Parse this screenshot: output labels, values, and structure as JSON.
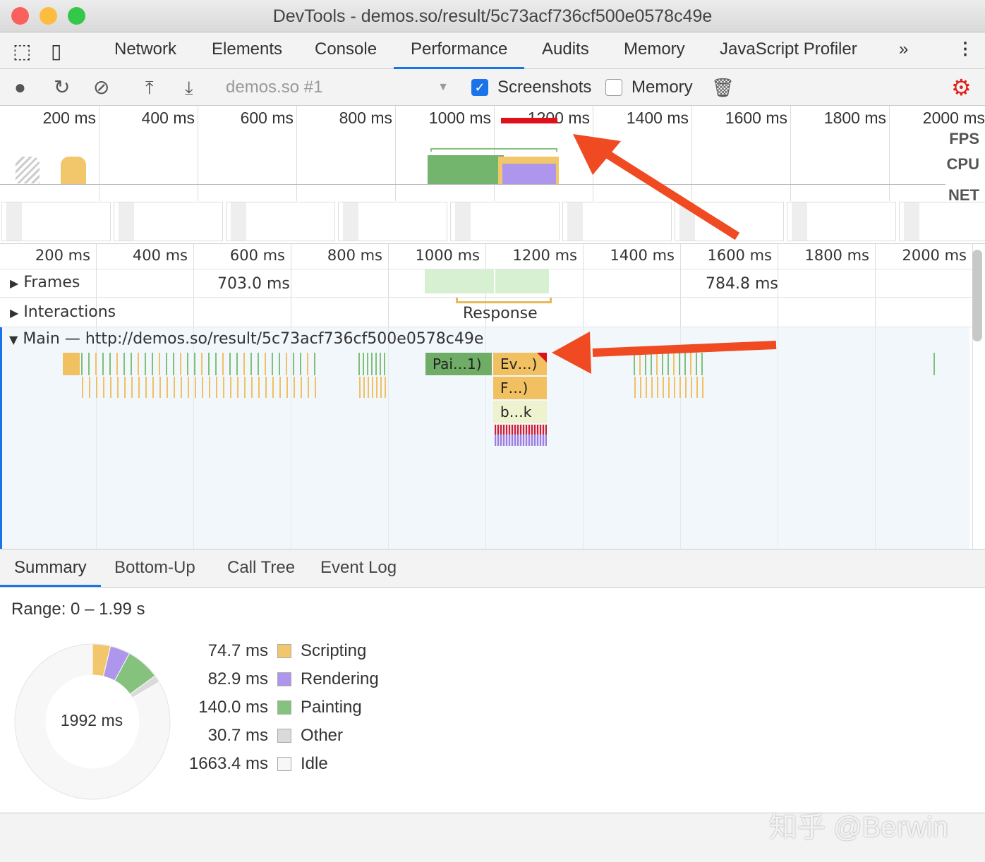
{
  "window": {
    "title": "DevTools - demos.so/result/5c73acf736cf500e0578c49e"
  },
  "tabs": [
    {
      "label": "Network"
    },
    {
      "label": "Elements"
    },
    {
      "label": "Console"
    },
    {
      "label": "Performance",
      "active": true
    },
    {
      "label": "Audits"
    },
    {
      "label": "Memory"
    },
    {
      "label": "JavaScript Profiler"
    }
  ],
  "toolbar": {
    "profile_select": "demos.so #1",
    "screenshots_label": "Screenshots",
    "screenshots_checked": true,
    "memory_label": "Memory",
    "memory_checked": false
  },
  "overview": {
    "ticks": [
      "200 ms",
      "400 ms",
      "600 ms",
      "800 ms",
      "1000 ms",
      "1200 ms",
      "1400 ms",
      "1600 ms",
      "1800 ms",
      "2000 ms"
    ],
    "fps_label": "FPS",
    "cpu_label": "CPU",
    "net_label": "NET"
  },
  "timeline": {
    "ticks": [
      "200 ms",
      "400 ms",
      "600 ms",
      "800 ms",
      "1000 ms",
      "1200 ms",
      "1400 ms",
      "1600 ms",
      "1800 ms",
      "2000 ms"
    ],
    "frames_label": "Frames",
    "frame_times": [
      "703.0 ms",
      "784.8 ms"
    ],
    "interactions_label": "Interactions",
    "response_label": "Response",
    "main_label": "Main — http://demos.so/result/5c73acf736cf500e0578c49e",
    "events": {
      "paint": "Pai…1)",
      "event": "Ev…)",
      "function": "F…)",
      "block": "b…k"
    }
  },
  "bottom_tabs": [
    {
      "label": "Summary",
      "active": true
    },
    {
      "label": "Bottom-Up"
    },
    {
      "label": "Call Tree"
    },
    {
      "label": "Event Log"
    }
  ],
  "summary": {
    "range": "Range: 0 – 1.99 s",
    "total": "1992 ms",
    "items": [
      {
        "value": "74.7 ms",
        "label": "Scripting",
        "ms": 74.7,
        "color": "#f2c66a"
      },
      {
        "value": "82.9 ms",
        "label": "Rendering",
        "ms": 82.9,
        "color": "#ad96ec"
      },
      {
        "value": "140.0 ms",
        "label": "Painting",
        "ms": 140.0,
        "color": "#85c27d"
      },
      {
        "value": "30.7 ms",
        "label": "Other",
        "ms": 30.7,
        "color": "#dadada"
      },
      {
        "value": "1663.4 ms",
        "label": "Idle",
        "ms": 1663.4,
        "color": "#f7f7f7"
      }
    ]
  },
  "watermark": "知乎 @Berwin",
  "colors": {
    "accent": "#1a73e8",
    "annotation_arrow": "#f04a23",
    "scripting": "#f2c66a",
    "painting": "#85c27d",
    "rendering": "#ad96ec"
  }
}
